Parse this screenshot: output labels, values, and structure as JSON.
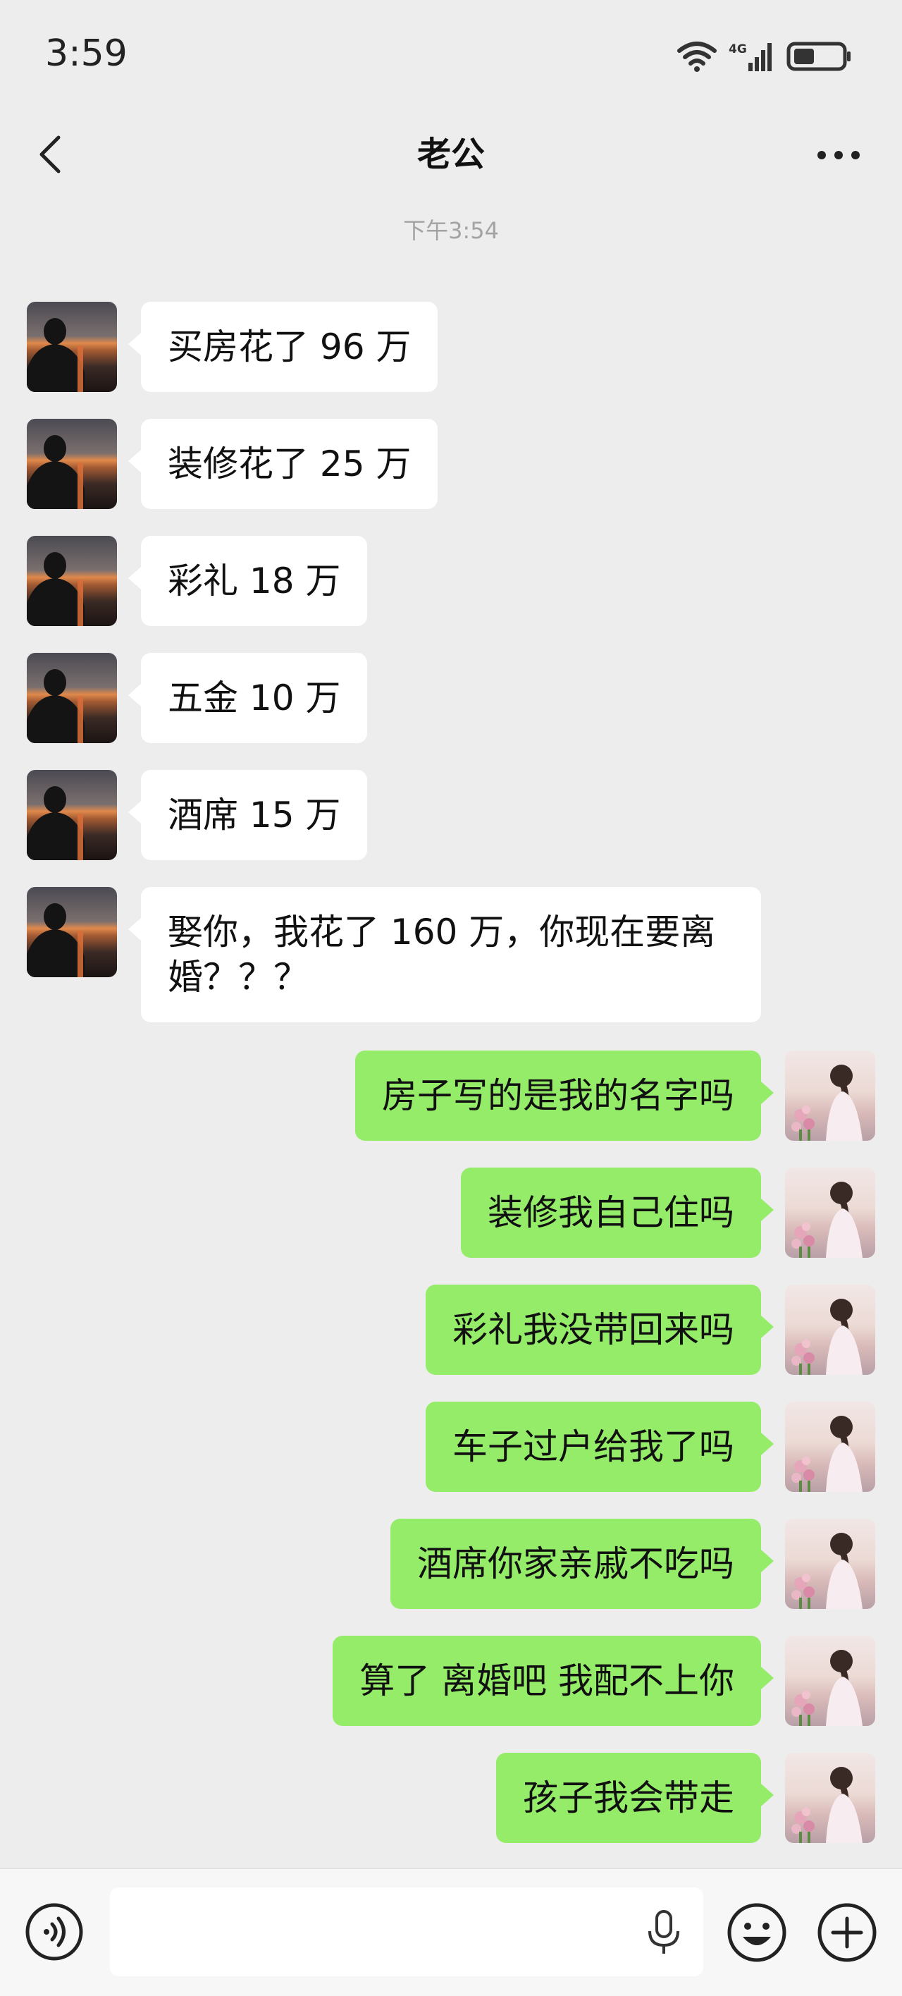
{
  "status_bar": {
    "time": "3:59",
    "network_label": "4G"
  },
  "header": {
    "title": "老公"
  },
  "timestamp": "下午3:54",
  "messages": [
    {
      "from": "him",
      "text": "买房花了 96 万"
    },
    {
      "from": "him",
      "text": "装修花了 25 万"
    },
    {
      "from": "him",
      "text": "彩礼 18 万"
    },
    {
      "from": "him",
      "text": "五金 10 万"
    },
    {
      "from": "him",
      "text": "酒席 15 万"
    },
    {
      "from": "him",
      "text": "娶你，我花了 160 万，你现在要离婚？？？"
    },
    {
      "from": "me",
      "text": "房子写的是我的名字吗"
    },
    {
      "from": "me",
      "text": "装修我自己住吗"
    },
    {
      "from": "me",
      "text": "彩礼我没带回来吗"
    },
    {
      "from": "me",
      "text": "车子过户给我了吗"
    },
    {
      "from": "me",
      "text": "酒席你家亲戚不吃吗"
    },
    {
      "from": "me",
      "text": "算了 离婚吧 我配不上你"
    },
    {
      "from": "me",
      "text": "孩子我会带走"
    }
  ],
  "input_bar": {
    "placeholder": "",
    "value": ""
  },
  "colors": {
    "background": "#ededed",
    "incoming_bubble": "#ffffff",
    "outgoing_bubble": "#95ec69"
  }
}
